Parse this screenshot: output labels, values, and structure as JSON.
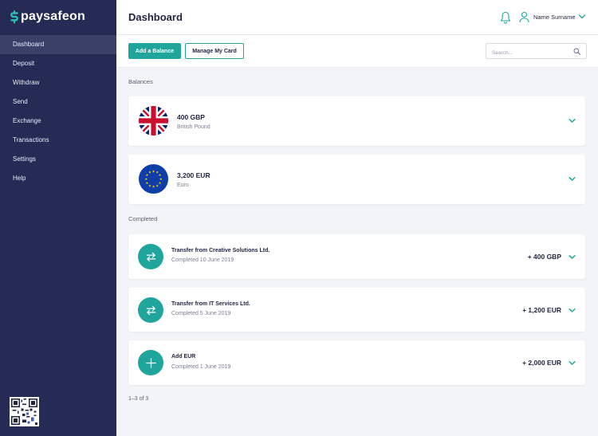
{
  "brand": {
    "name": "paysafeon"
  },
  "sidebar": {
    "items": [
      {
        "label": "Dashboard",
        "active": true
      },
      {
        "label": "Deposit"
      },
      {
        "label": "Withdraw"
      },
      {
        "label": "Send"
      },
      {
        "label": "Exchange"
      },
      {
        "label": "Transactions"
      },
      {
        "label": "Settings"
      },
      {
        "label": "Help"
      }
    ]
  },
  "header": {
    "title": "Dashboard",
    "user_name": "Name Surname",
    "icons": [
      "bell-icon",
      "user-icon",
      "chevron-down-icon"
    ]
  },
  "toolbar": {
    "add_balance_label": "Add a Balance",
    "manage_card_label": "Manage My Card",
    "search_placeholder": "Search..."
  },
  "balances": {
    "section_label": "Balances",
    "items": [
      {
        "amount": "400 GBP",
        "currency_name": "British Pound",
        "flag": "uk-flag"
      },
      {
        "amount": "3,200 EUR",
        "currency_name": "Euro",
        "flag": "eu-flag"
      }
    ]
  },
  "completed": {
    "section_label": "Completed",
    "items": [
      {
        "title": "Transfer from Creative Solutions Ltd.",
        "subtitle": "Completed 10 June 2019",
        "amount": "+ 400 GBP",
        "icon": "transfer-icon"
      },
      {
        "title": "Transfer from IT Services Ltd.",
        "subtitle": "Completed 5 June 2019",
        "amount": "+ 1,200 EUR",
        "icon": "transfer-icon"
      },
      {
        "title": "Add EUR",
        "subtitle": "Completed 1 June 2019",
        "amount": "+ 2,000 EUR",
        "icon": "plus-icon"
      }
    ]
  },
  "pagination": {
    "text": "1–3 of 3"
  },
  "colors": {
    "sidebar": "#262b55",
    "accent": "#1fa59b",
    "background": "#f2f4f7"
  }
}
